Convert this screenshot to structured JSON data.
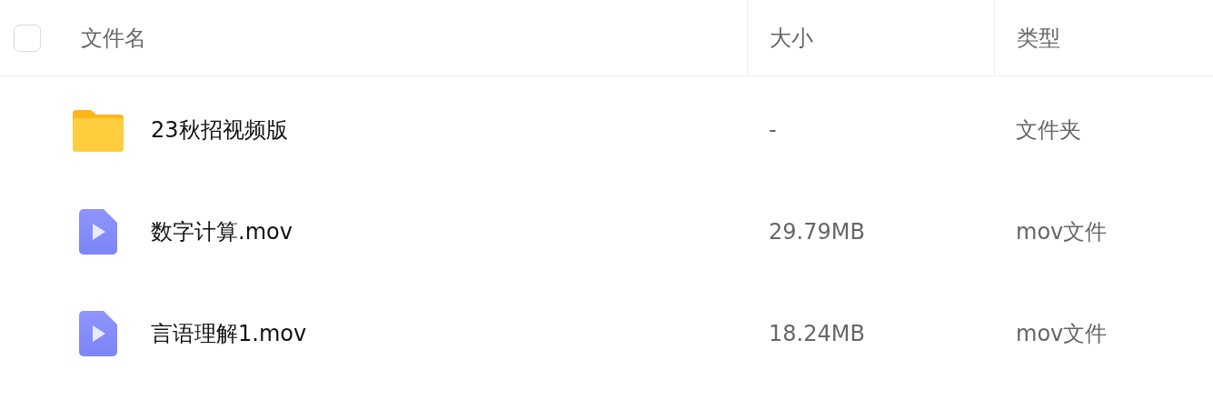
{
  "header": {
    "select_all": {
      "checked": false
    },
    "columns": [
      "文件名",
      "大小",
      "类型"
    ]
  },
  "rows": [
    {
      "kind": "folder",
      "name": "23秋招视频版",
      "size": "-",
      "type": "文件夹"
    },
    {
      "kind": "video",
      "name": "数字计算.mov",
      "size": "29.79MB",
      "type": "mov文件"
    },
    {
      "kind": "video",
      "name": "言语理解1.mov",
      "size": "18.24MB",
      "type": "mov文件"
    }
  ]
}
